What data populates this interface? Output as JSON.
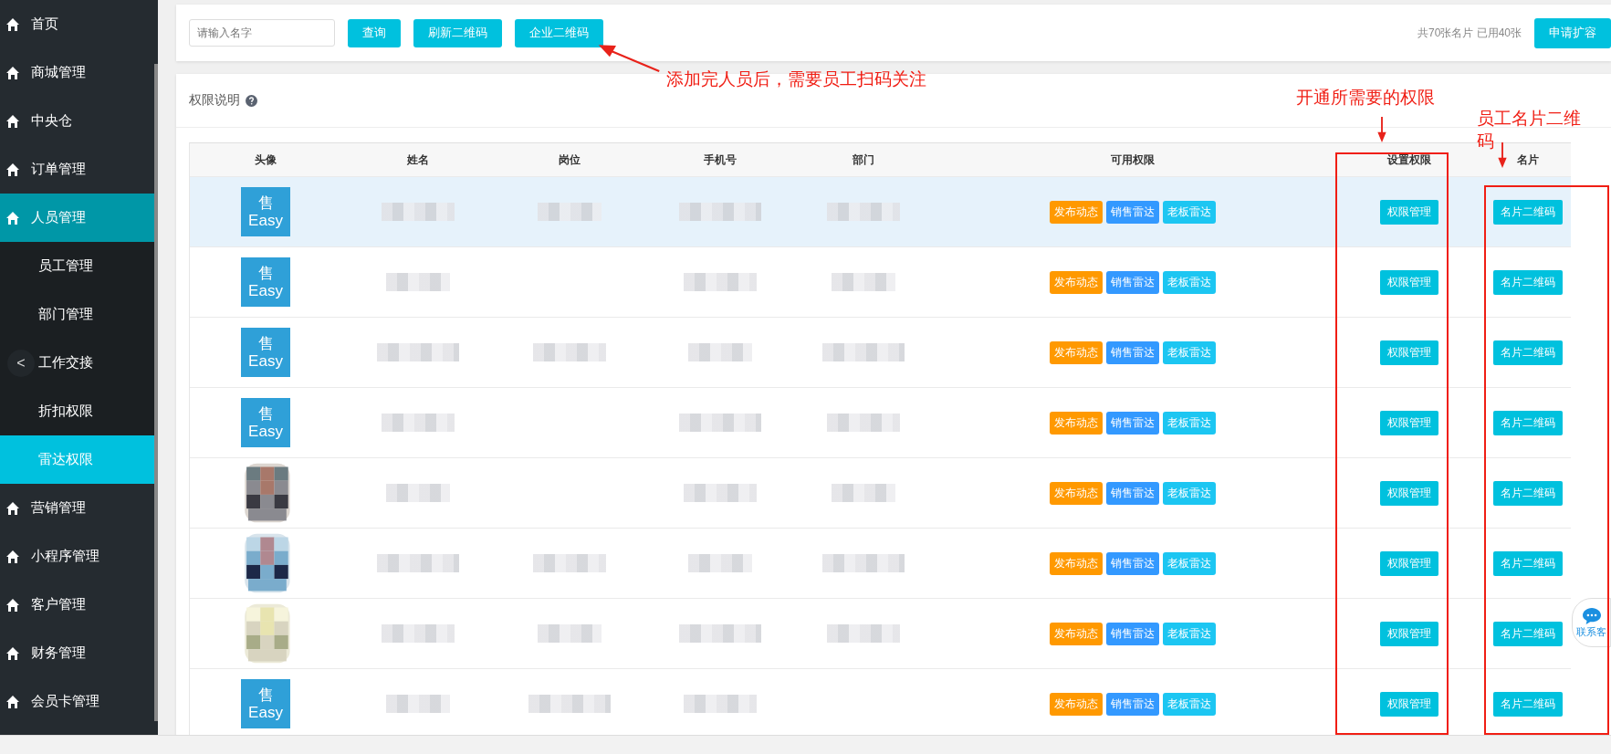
{
  "sidebar": {
    "items": [
      {
        "label": "首页",
        "selected": false
      },
      {
        "label": "商城管理",
        "selected": false
      },
      {
        "label": "中央仓",
        "selected": false
      },
      {
        "label": "订单管理",
        "selected": false
      },
      {
        "label": "人员管理",
        "selected": true,
        "expanded": true,
        "children": [
          {
            "label": "员工管理",
            "selected": false
          },
          {
            "label": "部门管理",
            "selected": false
          },
          {
            "label": "工作交接",
            "selected": false
          },
          {
            "label": "折扣权限",
            "selected": false
          },
          {
            "label": "雷达权限",
            "selected": true
          }
        ]
      },
      {
        "label": "营销管理",
        "selected": false
      },
      {
        "label": "小程序管理",
        "selected": false
      },
      {
        "label": "客户管理",
        "selected": false
      },
      {
        "label": "财务管理",
        "selected": false
      },
      {
        "label": "会员卡管理",
        "selected": false
      }
    ],
    "collapse_button": "<"
  },
  "toolbar": {
    "search": {
      "placeholder": "请输入名字"
    },
    "buttons": [
      "查询",
      "刷新二维码",
      "企业二维码"
    ],
    "quota": "共70张名片 已用40张",
    "expand_button": "申请扩容"
  },
  "section_title": "权限说明",
  "table": {
    "columns": [
      "头像",
      "姓名",
      "岗位",
      "手机号",
      "部门",
      "可用权限",
      "设置权限",
      "名片"
    ],
    "rows": [
      {
        "avatar": {
          "kind": "logo",
          "mark": "售",
          "word": "Easy"
        },
        "blurred": {
          "name": true,
          "position": true,
          "phone": true,
          "department": true
        },
        "tags": [
          {
            "label": "发布动态",
            "color": "#ff9900"
          },
          {
            "label": "销售雷达",
            "color": "#3399ff"
          },
          {
            "label": "老板雷达",
            "color": "#1cc6f2"
          }
        ],
        "manage_button": "权限管理",
        "card_button": "名片二维码",
        "selected": true
      },
      {
        "avatar": {
          "kind": "logo",
          "mark": "售",
          "word": "Easy"
        },
        "blurred": {
          "name": true,
          "position": false,
          "phone": true,
          "department": true
        },
        "tags": [
          {
            "label": "发布动态",
            "color": "#ff9900"
          },
          {
            "label": "销售雷达",
            "color": "#3399ff"
          },
          {
            "label": "老板雷达",
            "color": "#1cc6f2"
          }
        ],
        "manage_button": "权限管理",
        "card_button": "名片二维码",
        "selected": false
      },
      {
        "avatar": {
          "kind": "logo",
          "mark": "售",
          "word": "Easy"
        },
        "blurred": {
          "name": true,
          "position": true,
          "phone": true,
          "department": true
        },
        "tags": [
          {
            "label": "发布动态",
            "color": "#ff9900"
          },
          {
            "label": "销售雷达",
            "color": "#3399ff"
          },
          {
            "label": "老板雷达",
            "color": "#1cc6f2"
          }
        ],
        "manage_button": "权限管理",
        "card_button": "名片二维码",
        "selected": false
      },
      {
        "avatar": {
          "kind": "logo",
          "mark": "售",
          "word": "Easy"
        },
        "blurred": {
          "name": true,
          "position": false,
          "phone": true,
          "department": true
        },
        "tags": [
          {
            "label": "发布动态",
            "color": "#ff9900"
          },
          {
            "label": "销售雷达",
            "color": "#3399ff"
          },
          {
            "label": "老板雷达",
            "color": "#1cc6f2"
          }
        ],
        "manage_button": "权限管理",
        "card_button": "名片二维码",
        "selected": false
      },
      {
        "blurred": {
          "name": true,
          "position": false,
          "phone": true,
          "department": true
        },
        "tags": [
          {
            "label": "发布动态",
            "color": "#ff9900"
          },
          {
            "label": "销售雷达",
            "color": "#3399ff"
          },
          {
            "label": "老板雷达",
            "color": "#1cc6f2"
          }
        ],
        "manage_button": "权限管理",
        "card_button": "名片二维码",
        "selected": false
      },
      {
        "blurred": {
          "name": true,
          "position": true,
          "phone": true,
          "department": true
        },
        "tags": [
          {
            "label": "发布动态",
            "color": "#ff9900"
          },
          {
            "label": "销售雷达",
            "color": "#3399ff"
          },
          {
            "label": "老板雷达",
            "color": "#1cc6f2"
          }
        ],
        "manage_button": "权限管理",
        "card_button": "名片二维码",
        "selected": false
      },
      {
        "blurred": {
          "name": true,
          "position": true,
          "phone": true,
          "department": true
        },
        "tags": [
          {
            "label": "发布动态",
            "color": "#ff9900"
          },
          {
            "label": "销售雷达",
            "color": "#3399ff"
          },
          {
            "label": "老板雷达",
            "color": "#1cc6f2"
          }
        ],
        "manage_button": "权限管理",
        "card_button": "名片二维码",
        "selected": false
      },
      {
        "avatar": {
          "kind": "logo",
          "mark": "售",
          "word": "Easy"
        },
        "blurred": {
          "name": true,
          "position": true,
          "phone": true,
          "department": false
        },
        "tags": [
          {
            "label": "发布动态",
            "color": "#ff9900"
          },
          {
            "label": "销售雷达",
            "color": "#3399ff"
          },
          {
            "label": "老板雷达",
            "color": "#1cc6f2"
          }
        ],
        "manage_button": "权限管理",
        "card_button": "名片二维码",
        "selected": false
      }
    ]
  },
  "chat_button": "联系客",
  "annotations": [
    {
      "kind": "note",
      "text": "添加完人员后，需要员工扫码关注"
    },
    {
      "kind": "column",
      "text": "开通所需要的权限"
    },
    {
      "kind": "column",
      "text": "员工名片二维码"
    }
  ]
}
